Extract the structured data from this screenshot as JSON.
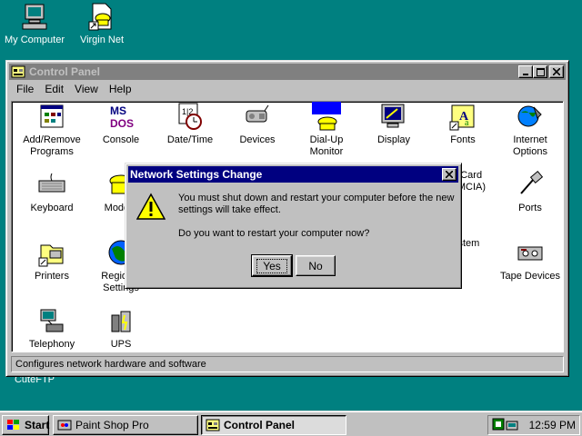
{
  "desktop": {
    "icons": [
      {
        "label": "My Computer",
        "icon": "my-computer-icon"
      },
      {
        "label": "Virgin Net",
        "icon": "virgin-net-icon"
      },
      {
        "label": "CuteFTP",
        "icon": "cuteftp-icon"
      }
    ]
  },
  "control_panel": {
    "title": "Control Panel",
    "menu": [
      "File",
      "Edit",
      "View",
      "Help"
    ],
    "items": [
      {
        "label": "Add/Remove Programs",
        "icon": "add-remove-programs-icon"
      },
      {
        "label": "Console",
        "icon": "console-icon"
      },
      {
        "label": "Date/Time",
        "icon": "date-time-icon"
      },
      {
        "label": "Devices",
        "icon": "devices-icon"
      },
      {
        "label": "Dial-Up Monitor",
        "icon": "dial-up-monitor-icon"
      },
      {
        "label": "Display",
        "icon": "display-icon"
      },
      {
        "label": "Fonts",
        "icon": "fonts-icon"
      },
      {
        "label": "Internet Options",
        "icon": "internet-options-icon"
      },
      {
        "label": "Keyboard",
        "icon": "keyboard-icon"
      },
      {
        "label": "Modem",
        "icon": "modem-icon"
      },
      {
        "label": "PC Card (PCMCIA)",
        "icon": "pc-card-icon"
      },
      {
        "label": "Ports",
        "icon": "ports-icon"
      },
      {
        "label": "Printers",
        "icon": "printers-icon"
      },
      {
        "label": "Regional Settings",
        "icon": "regional-settings-icon"
      },
      {
        "label": "System",
        "icon": "system-icon"
      },
      {
        "label": "Tape Devices",
        "icon": "tape-devices-icon"
      },
      {
        "label": "Telephony",
        "icon": "telephony-icon"
      },
      {
        "label": "UPS",
        "icon": "ups-icon"
      }
    ],
    "status": "Configures network hardware and software"
  },
  "dialog": {
    "title": "Network Settings Change",
    "line1": "You must shut down and restart your computer before the new settings will take effect.",
    "line2": "Do you want to restart your computer now?",
    "yes": "Yes",
    "no": "No",
    "icon": "warning-icon"
  },
  "taskbar": {
    "start": "Start",
    "tasks": [
      {
        "label": "Paint Shop Pro",
        "active": false
      },
      {
        "label": "Control Panel",
        "active": true
      }
    ],
    "clock": "12:59 PM"
  }
}
